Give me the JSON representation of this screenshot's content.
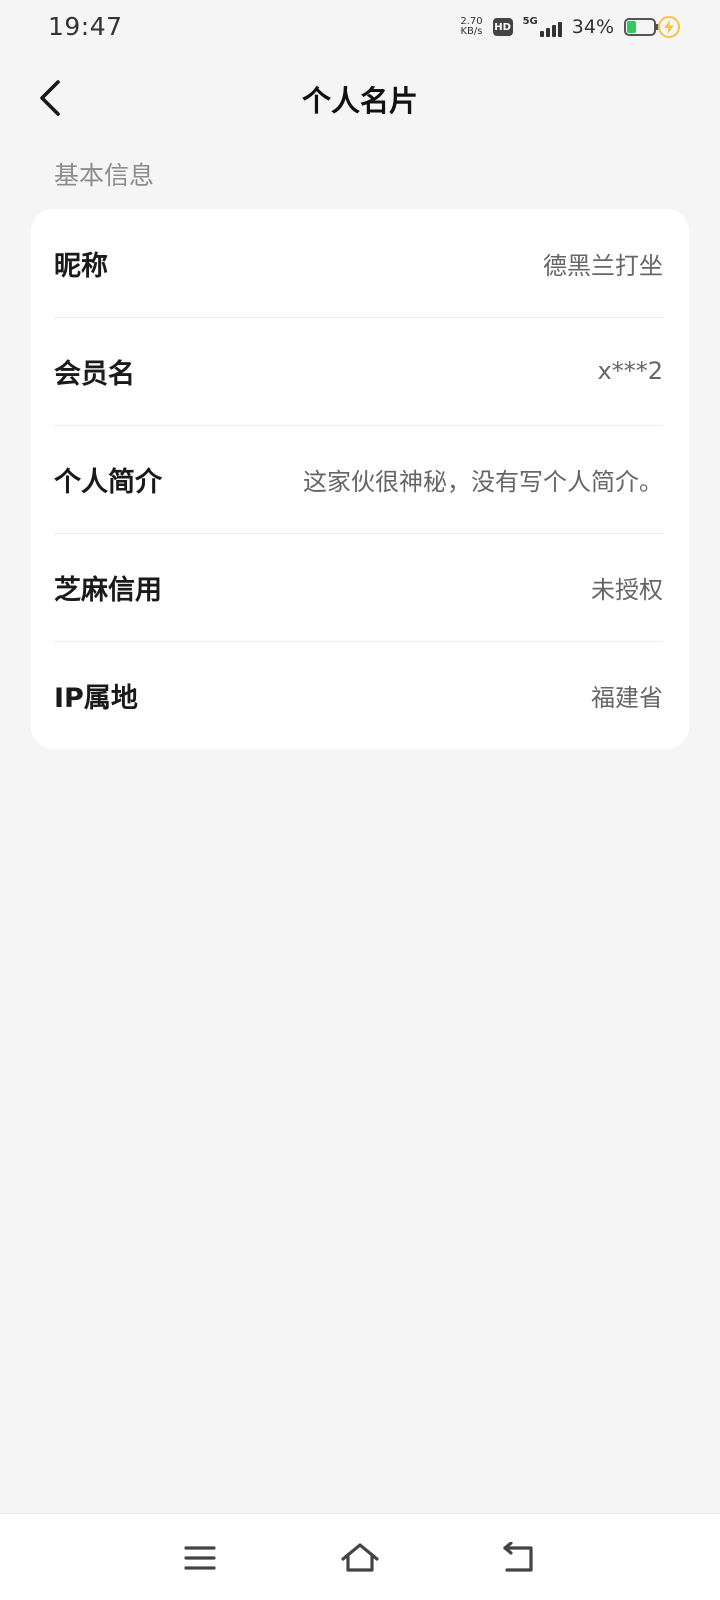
{
  "status_bar": {
    "time": "19:47",
    "net_speed_value": "2.70",
    "net_speed_unit": "KB/s",
    "hd_label": "HD",
    "network_label": "5G",
    "battery_percent": "34%",
    "battery_level": 0.34,
    "battery_color": "#34c759",
    "charging_color": "#f6c445"
  },
  "header": {
    "back_icon": "chevron-left-icon",
    "title": "个人名片"
  },
  "section": {
    "label": "基本信息",
    "rows": [
      {
        "label": "昵称",
        "value": "德黑兰打坐"
      },
      {
        "label": "会员名",
        "value": "x***2"
      },
      {
        "label": "个人简介",
        "value": "这家伙很神秘，没有写个人简介。"
      },
      {
        "label": "芝麻信用",
        "value": "未授权"
      },
      {
        "label": "IP属地",
        "value": "福建省"
      }
    ]
  },
  "nav_bar": {
    "icons": [
      "menu-icon",
      "home-icon",
      "back-icon"
    ]
  }
}
